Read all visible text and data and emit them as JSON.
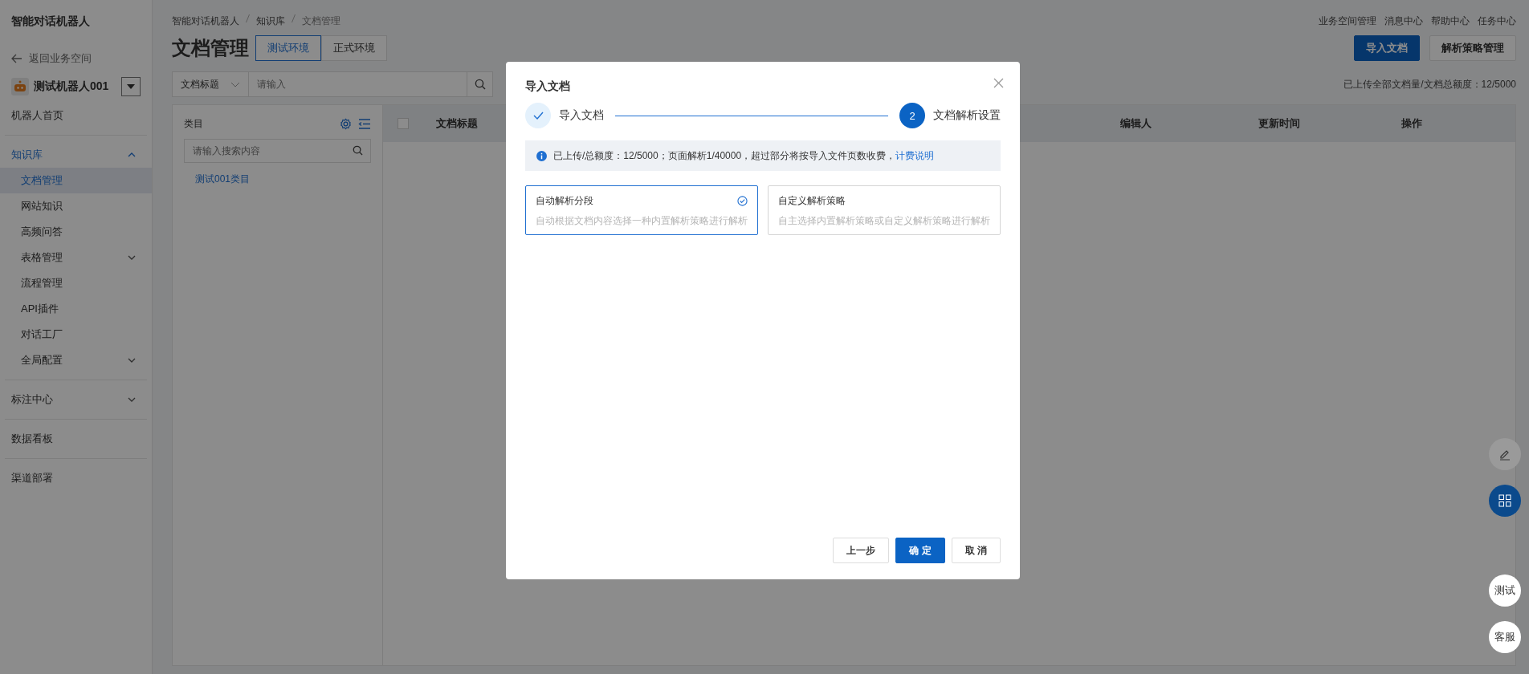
{
  "app_title": "智能对话机器人",
  "back_link": "返回业务空间",
  "bot": {
    "name": "测试机器人001"
  },
  "sidebar": {
    "groups": [
      {
        "items": [
          {
            "label": "机器人首页",
            "selected": false
          }
        ]
      },
      {
        "items": [
          {
            "label": "知识库",
            "selected": false,
            "expanded": true,
            "children": [
              {
                "label": "文档管理",
                "selected": true
              },
              {
                "label": "网站知识",
                "selected": false
              },
              {
                "label": "高频问答",
                "selected": false
              },
              {
                "label": "表格管理",
                "selected": false,
                "expanded": false
              },
              {
                "label": "流程管理",
                "selected": false
              },
              {
                "label": "API插件",
                "selected": false
              },
              {
                "label": "对话工厂",
                "selected": false
              },
              {
                "label": "全局配置",
                "selected": false,
                "expanded": false
              }
            ]
          }
        ]
      },
      {
        "items": [
          {
            "label": "标注中心",
            "selected": false,
            "expanded": false
          }
        ]
      },
      {
        "items": [
          {
            "label": "数据看板",
            "selected": false
          }
        ]
      },
      {
        "items": [
          {
            "label": "渠道部署",
            "selected": false
          }
        ]
      }
    ]
  },
  "breadcrumb": [
    "智能对话机器人",
    "知识库",
    "文档管理"
  ],
  "page_title": "文档管理",
  "env_tabs": [
    {
      "label": "测试环境",
      "selected": true
    },
    {
      "label": "正式环境",
      "selected": false
    }
  ],
  "top_links": [
    "业务空间管理",
    "消息中心",
    "帮助中心",
    "任务中心"
  ],
  "actions": [
    {
      "label": "导入文档",
      "kind": "primary"
    },
    {
      "label": "解析策略管理",
      "kind": "default"
    }
  ],
  "search": {
    "field": "文档标题",
    "placeholder": "请输入"
  },
  "quota": "已上传全部文档量/文档总额度：12/5000",
  "category": {
    "title": "类目",
    "search_placeholder": "请输入搜索内容",
    "items": [
      {
        "label": "测试001类目"
      }
    ]
  },
  "table": {
    "select_all": {
      "checked": false
    },
    "columns": [
      "文档标题",
      "编辑人",
      "更新时间",
      "操作"
    ]
  },
  "dialog": {
    "title": "导入文档",
    "steps": [
      {
        "label": "导入文档",
        "done": true
      },
      {
        "label": "文档解析设置",
        "done": false,
        "number": "2"
      }
    ],
    "notice": {
      "text": "已上传/总额度：12/5000；页面解析1/40000，超过部分将按导入文件页数收费，",
      "link": "计费说明"
    },
    "options": [
      {
        "title": "自动解析分段",
        "description": "自动根据文档内容选择一种内置解析策略进行解析",
        "selected": true
      },
      {
        "title": "自定义解析策略",
        "description": "自主选择内置解析策略或自定义解析策略进行解析",
        "selected": false
      }
    ],
    "buttons": [
      {
        "label": "上一步",
        "kind": "default"
      },
      {
        "label": "确 定",
        "kind": "primary"
      },
      {
        "label": "取 消",
        "kind": "default"
      }
    ]
  },
  "float_buttons": [
    {
      "kind": "edit"
    },
    {
      "kind": "apps"
    },
    {
      "kind": "text",
      "label": "测试"
    },
    {
      "kind": "text",
      "label": "客服"
    }
  ]
}
